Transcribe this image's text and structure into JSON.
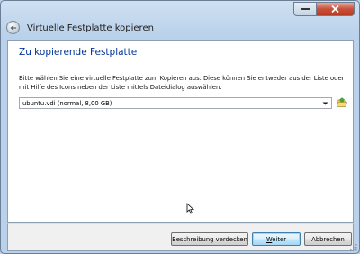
{
  "window": {
    "title": "Virtuelle Festplatte kopieren"
  },
  "page": {
    "heading": "Zu kopierende Festplatte",
    "description": "Bitte wählen Sie eine virtuelle Festplatte zum Kopieren aus. Diese können Sie entweder aus der Liste oder mit Hilfe des Icons neben der Liste mittels Dateidialog auswählen."
  },
  "disk_select": {
    "selected": "ubuntu.vdi (normal, 8,00 GB)"
  },
  "buttons": {
    "hide_description": "Beschreibung verdecken",
    "next_prefix": "",
    "next_mnemonic": "W",
    "next_rest": "eiter",
    "cancel": "Abbrechen"
  },
  "icons": {
    "back": "back-arrow-icon",
    "minimize": "minimize-icon",
    "close": "close-icon",
    "dropdown": "chevron-down-icon",
    "open_file": "folder-open-icon"
  },
  "colors": {
    "heading": "#003399",
    "window_frame": "#b9d1ea",
    "close_button": "#c7513a"
  }
}
